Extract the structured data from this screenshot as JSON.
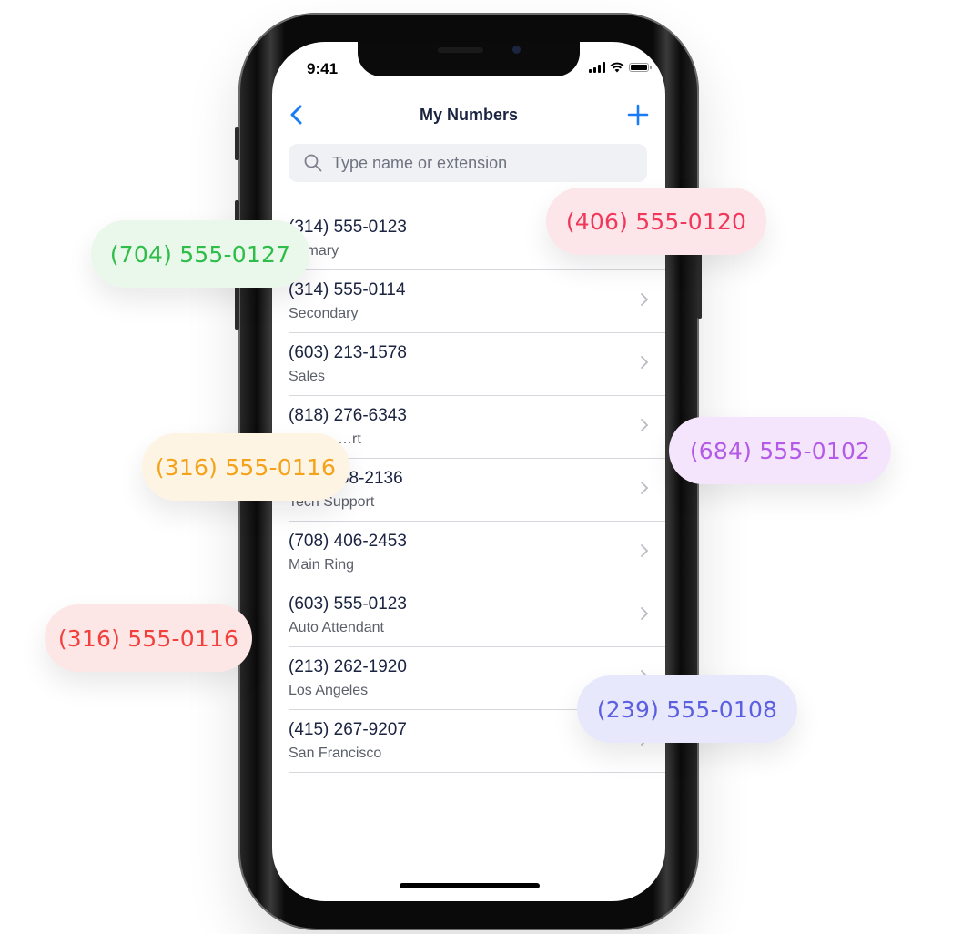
{
  "status_bar": {
    "time": "9:41"
  },
  "nav": {
    "title": "My Numbers",
    "back_icon": "chevron-left-icon",
    "add_icon": "plus-icon"
  },
  "search": {
    "placeholder": "Type name or extension",
    "value": ""
  },
  "accent_color": "#1a7cf5",
  "numbers": [
    {
      "number": "(314) 555-0123",
      "label": "Primary"
    },
    {
      "number": "(314) 555-0114",
      "label": "Secondary"
    },
    {
      "number": "(603) 213-1578",
      "label": "Sales"
    },
    {
      "number": "(818) 276-6343",
      "label": "…rt"
    },
    {
      "number": "(…) …58-2136",
      "label": "Tech Support"
    },
    {
      "number": "(708) 406-2453",
      "label": "Main Ring"
    },
    {
      "number": "(603) 555-0123",
      "label": "Auto Attendant"
    },
    {
      "number": "(213) 262-1920",
      "label": "Los Angeles"
    },
    {
      "number": "(415) 267-9207",
      "label": "San Francisco"
    }
  ],
  "badges": [
    {
      "number": "(704) 555-0127",
      "text_color": "#2ebd48",
      "bg_color": "#eaf8ec"
    },
    {
      "number": "(406) 555-0120",
      "text_color": "#f2385a",
      "bg_color": "#fde6ea"
    },
    {
      "number": "(316) 555-0116",
      "text_color": "#f5a21b",
      "bg_color": "#fef4e3"
    },
    {
      "number": "(684) 555-0102",
      "text_color": "#b45ae6",
      "bg_color": "#f5e5fc"
    },
    {
      "number": "(316) 555-0116",
      "text_color": "#f2403c",
      "bg_color": "#fde6e6"
    },
    {
      "number": "(239) 555-0108",
      "text_color": "#5b5fe0",
      "bg_color": "#e7e8fb"
    }
  ]
}
